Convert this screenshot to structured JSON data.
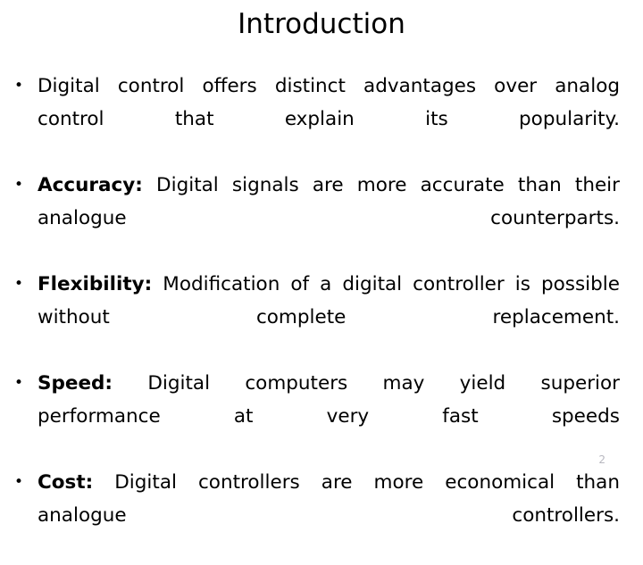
{
  "slide": {
    "title": "Introduction",
    "page_number": "2",
    "bullet_marker": "•",
    "background_color": "#ffffff",
    "text_color": "#000000",
    "page_number_color": "#b8b8c0",
    "bullets": [
      {
        "label": "",
        "text": "Digital control offers distinct advantages over analog control that explain its popularity."
      },
      {
        "label": "Accuracy:",
        "text": " Digital signals are more accurate than their analogue counterparts."
      },
      {
        "label": "Flexibility:",
        "text": " Modification of a digital controller is possible without complete replacement."
      },
      {
        "label": "Speed:",
        "text": " Digital computers may yield superior performance at very fast speeds"
      },
      {
        "label": "Cost:",
        "text": " Digital controllers are more economical than analogue controllers."
      }
    ]
  }
}
